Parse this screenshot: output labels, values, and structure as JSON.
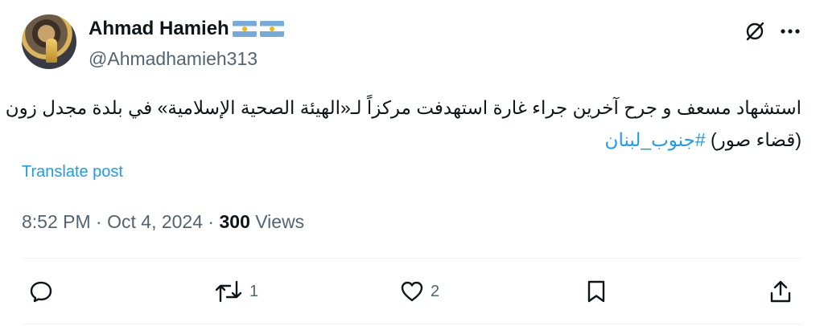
{
  "author": {
    "name": "Ahmad Hamieh",
    "handle": "@Ahmadhamieh313",
    "flags": [
      "argentina-flag",
      "argentina-flag"
    ]
  },
  "tweet": {
    "line1": "استشهاد مسعف و جرح آخرين جراء غارة استهدفت مركزاً لـ«الهيئة الصحية الإسلامية» في بلدة مجدل زون",
    "line2_text": "(قضاء صور) ",
    "hashtag": "#جنوب_لبنان",
    "translate_label": "Translate post"
  },
  "meta": {
    "time": "8:52 PM",
    "separator1": " · ",
    "date": "Oct 4, 2024",
    "separator2": " · ",
    "views_count": "300",
    "views_label": " Views"
  },
  "actions": {
    "reply_count": "",
    "retweet_count": "1",
    "like_count": "2"
  },
  "icons": {
    "grok": "grok-icon",
    "more": "more-icon",
    "reply": "reply-icon",
    "retweet": "retweet-icon",
    "like": "heart-icon",
    "bookmark": "bookmark-icon",
    "share": "share-icon"
  },
  "colors": {
    "accent": "#1d9bf0",
    "text": "#0f1419",
    "secondary": "#536471"
  }
}
